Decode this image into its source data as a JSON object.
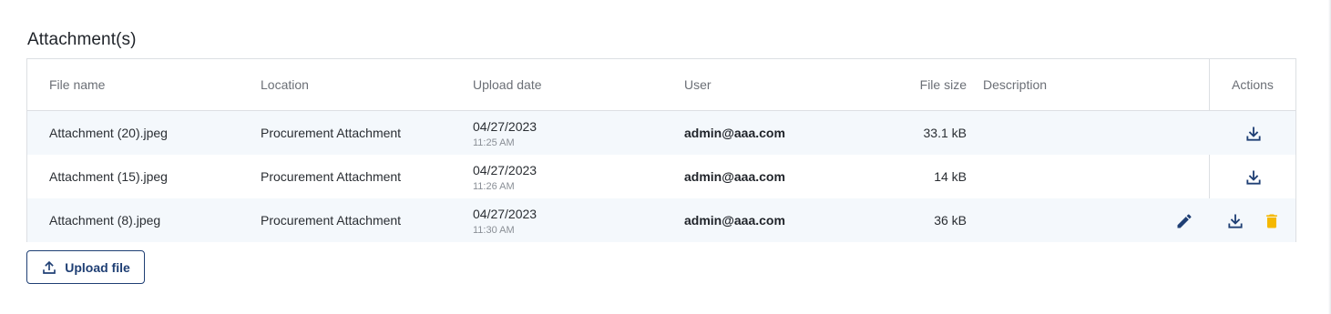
{
  "section": {
    "title": "Attachment(s)"
  },
  "table": {
    "columns": {
      "file_name": "File name",
      "location": "Location",
      "upload_date": "Upload date",
      "user": "User",
      "file_size": "File size",
      "description": "Description",
      "actions": "Actions"
    },
    "rows": [
      {
        "file_name": "Attachment (20).jpeg",
        "location": "Procurement Attachment",
        "date": "04/27/2023",
        "time": "11:25 AM",
        "user": "admin@aaa.com",
        "size": "33.1 kB",
        "description": ""
      },
      {
        "file_name": "Attachment (15).jpeg",
        "location": "Procurement Attachment",
        "date": "04/27/2023",
        "time": "11:26 AM",
        "user": "admin@aaa.com",
        "size": "14 kB",
        "description": ""
      },
      {
        "file_name": "Attachment (8).jpeg",
        "location": "Procurement Attachment",
        "date": "04/27/2023",
        "time": "11:30 AM",
        "user": "admin@aaa.com",
        "size": "36 kB",
        "description": ""
      }
    ]
  },
  "upload_button": {
    "label": "Upload file"
  },
  "icons": {
    "download": "download-icon",
    "edit": "pencil-icon",
    "delete": "trash-icon",
    "upload": "upload-icon"
  },
  "colors": {
    "primary": "#1f3f74",
    "delete": "#f5b800",
    "row_shade": "#f4f8fc",
    "border": "#dcdfe3"
  }
}
